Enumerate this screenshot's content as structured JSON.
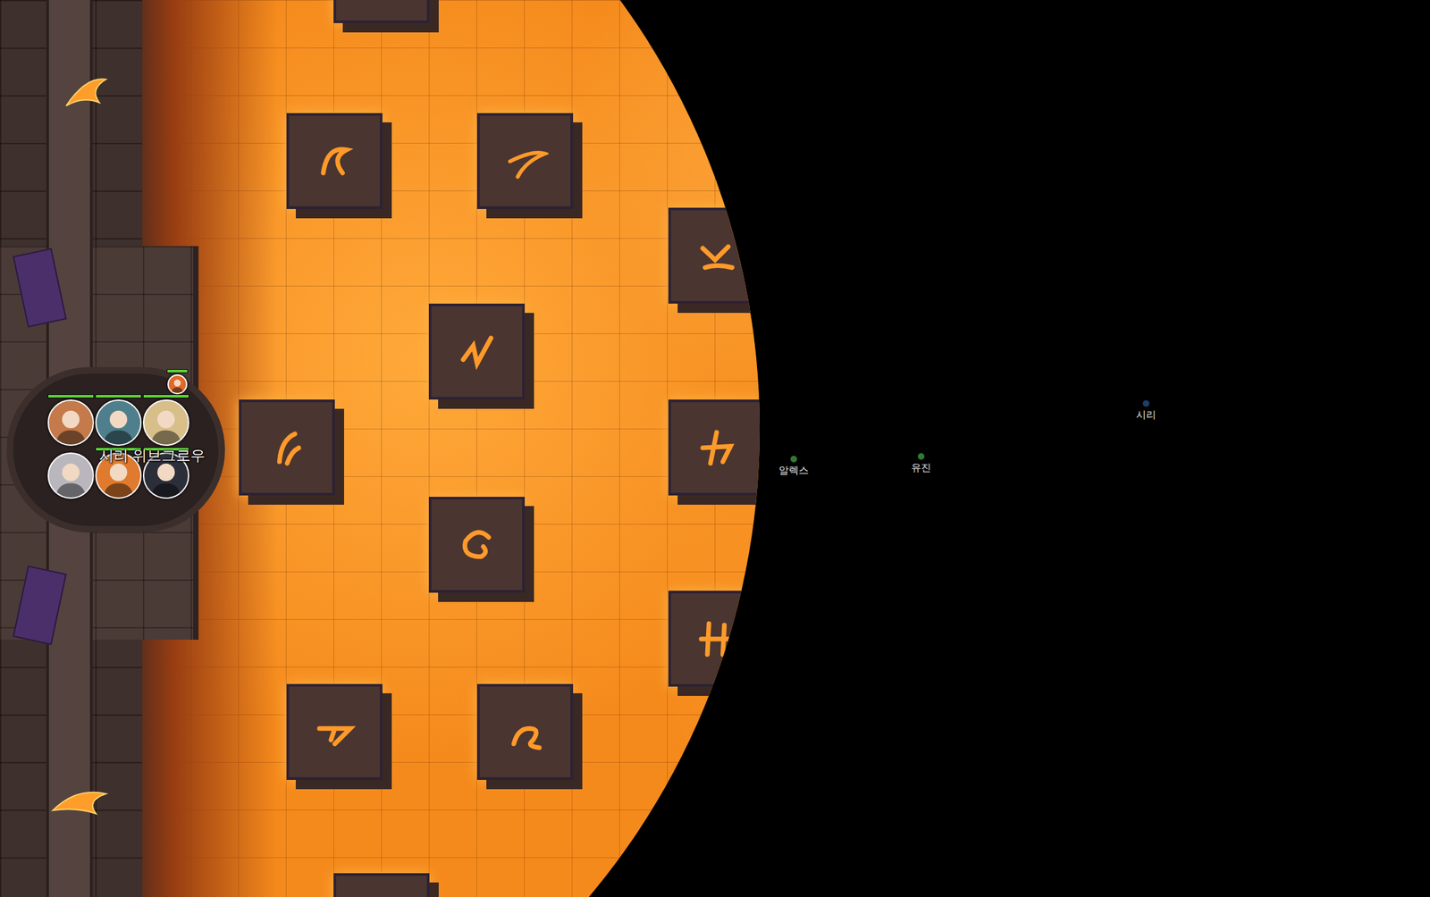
{
  "tokens": [
    {
      "color": "#c47a4a",
      "show_hp": true,
      "hp_level": 1
    },
    {
      "color": "#4f7f8c",
      "show_hp": true,
      "hp_level": 1
    },
    {
      "color": "#d8bf8a",
      "show_hp": true,
      "hp_level": 1
    },
    {
      "color": "#b9b6bd",
      "show_hp": false
    },
    {
      "color": "#e07a2e",
      "show_hp": true,
      "hp_level": 1
    },
    {
      "color": "#2c2f3a",
      "show_hp": true,
      "hp_level": 1
    }
  ],
  "marker": {
    "color": "#e0692a",
    "hp_level": 1
  },
  "token_label": "시리 위브그로우",
  "pins": [
    {
      "label": "알렉스",
      "color": "#2f7a32"
    },
    {
      "label": "유진",
      "color": "#2f7a32"
    },
    {
      "label": "시리",
      "color": "#1f3f66"
    }
  ]
}
